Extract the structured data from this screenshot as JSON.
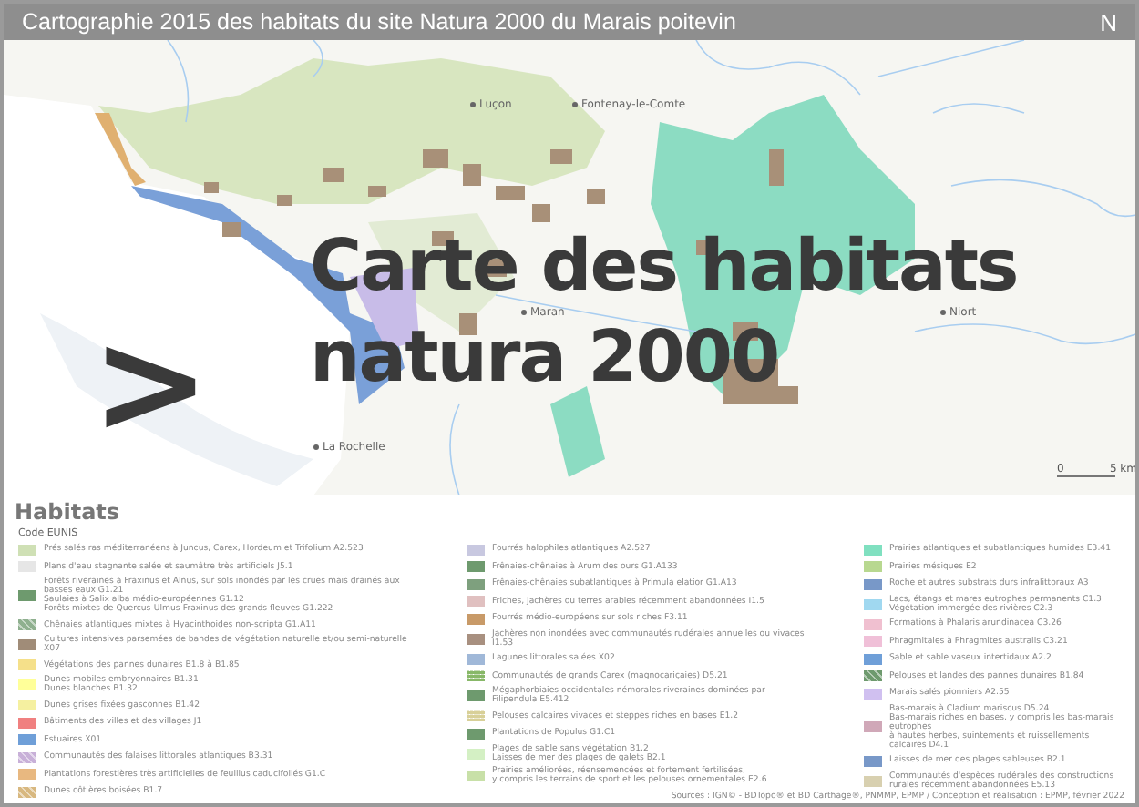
{
  "header": {
    "title": "Cartographie 2015 des habitats du site Natura 2000 du Marais poitevin",
    "north": "N"
  },
  "map": {
    "places": [
      {
        "name": "Luçon"
      },
      {
        "name": "Fontenay-le-Comte"
      },
      {
        "name": "Maran"
      },
      {
        "name": "Niort"
      },
      {
        "name": "La Rochelle"
      }
    ],
    "scale": {
      "start": "0",
      "end": "5 km"
    },
    "overlay": {
      "arrow": ">",
      "title_lines": [
        "Carte des habitats",
        "natura 2000"
      ]
    }
  },
  "legend": {
    "title": "Habitats",
    "subtitle": "Code EUNIS",
    "columns": [
      [
        {
          "lines": [
            "Prés salés ras méditerranéens à Juncus, Carex, Hordeum et Trifolium A2.523"
          ],
          "color": "#cfe0b5",
          "kind": "plain"
        },
        {
          "lines": [
            "Plans d'eau stagnante salée et saumâtre très artificiels J5.1"
          ],
          "color": "#e6e6e6",
          "kind": "plain"
        },
        {
          "lines": [
            "Forêts riveraines à Fraxinus et Alnus, sur sols inondés par les crues mais drainés aux basses eaux G1.21",
            "Saulaies à Salix alba médio-européennes G1.12",
            "Forêts mixtes de Quercus-Ulmus-Fraxinus des grands fleuves G1.222"
          ],
          "color": "#6e9a6e",
          "kind": "plain"
        },
        {
          "lines": [
            "Chênaies atlantiques mixtes à Hyacinthoides non-scripta G1.A11"
          ],
          "color": "#8fb08f",
          "kind": "hatched"
        },
        {
          "lines": [
            "Cultures intensives parsemées de bandes de végétation naturelle et/ou semi-naturelle X07"
          ],
          "color": "#a08c78",
          "kind": "plain"
        },
        {
          "lines": [
            "Végétations des pannes dunaires B1.8 à B1.85"
          ],
          "color": "#f5e08a",
          "kind": "plain"
        },
        {
          "lines": [
            "Dunes mobiles embryonnaires B1.31",
            "Dunes blanches B1.32"
          ],
          "color": "#ffff99",
          "kind": "plain"
        },
        {
          "lines": [
            "Dunes grises fixées gasconnes B1.42"
          ],
          "color": "#f5f0a0",
          "kind": "plain"
        },
        {
          "lines": [
            "Bâtiments des villes et des villages J1"
          ],
          "color": "#f08080",
          "kind": "plain"
        },
        {
          "lines": [
            "Estuaires X01"
          ],
          "color": "#6f9fd8",
          "kind": "plain"
        },
        {
          "lines": [
            "Communautés des falaises littorales atlantiques B3.31"
          ],
          "color": "#c8b0d8",
          "kind": "hatched"
        },
        {
          "lines": [
            "Plantations forestières très artificielles de feuillus caducifoliés G1.C"
          ],
          "color": "#e8b880",
          "kind": "plain"
        },
        {
          "lines": [
            "Dunes côtières boisées B1.7"
          ],
          "color": "#d8b880",
          "kind": "hatched"
        }
      ],
      [
        {
          "lines": [
            "Fourrés halophiles atlantiques A2.527"
          ],
          "color": "#c8c8e0",
          "kind": "plain"
        },
        {
          "lines": [
            "Frênaies-chênaies à Arum des ours G1.A133"
          ],
          "color": "#6e9a6e",
          "kind": "plain"
        },
        {
          "lines": [
            "Frênaies-chênaies subatlantiques à Primula elatior G1.A13"
          ],
          "color": "#7ea07e",
          "kind": "plain"
        },
        {
          "lines": [
            "Friches, jachères ou terres arables récemment abandonnées I1.5"
          ],
          "color": "#e0c0c0",
          "kind": "plain"
        },
        {
          "lines": [
            "Fourrés médio-européens sur sols riches F3.11"
          ],
          "color": "#c89a68",
          "kind": "plain"
        },
        {
          "lines": [
            "Jachères non inondées avec communautés rudérales annuelles ou vivaces I1.53"
          ],
          "color": "#a89080",
          "kind": "plain"
        },
        {
          "lines": [
            "Lagunes littorales salées X02"
          ],
          "color": "#a0b8d8",
          "kind": "plain"
        },
        {
          "lines": [
            "Communautés de grands Carex (magnocariçaies) D5.21"
          ],
          "color": "#88b868",
          "kind": "grid"
        },
        {
          "lines": [
            "Mégaphorbiaies occidentales némorales riveraines dominées par Filipendula E5.412"
          ],
          "color": "#6e9a6e",
          "kind": "plain"
        },
        {
          "lines": [
            "Pelouses calcaires vivaces et steppes riches en bases E1.2"
          ],
          "color": "#d8d098",
          "kind": "grid"
        },
        {
          "lines": [
            "Plantations de Populus G1.C1"
          ],
          "color": "#6e9a6e",
          "kind": "plain"
        },
        {
          "lines": [
            "Plages de sable sans végétation B1.2",
            "Laisses de mer des plages de galets B2.1"
          ],
          "color": "#d4f0c4",
          "kind": "plain"
        },
        {
          "lines": [
            "Prairies améliorées, réensemencées et fortement fertilisées,",
            "y compris les terrains de sport et les pelouses ornementales E2.6"
          ],
          "color": "#c8e0a8",
          "kind": "plain"
        }
      ],
      [
        {
          "lines": [
            "Prairies atlantiques et subatlantiques humides E3.41"
          ],
          "color": "#80e0c0",
          "kind": "plain"
        },
        {
          "lines": [
            "Prairies mésiques E2"
          ],
          "color": "#b8d890",
          "kind": "plain"
        },
        {
          "lines": [
            "Roche et autres substrats durs infralittoraux A3"
          ],
          "color": "#7898c8",
          "kind": "plain"
        },
        {
          "lines": [
            "Lacs, étangs et mares eutrophes permanents C1.3",
            "Végétation immergée des rivières C2.3"
          ],
          "color": "#a0d8f0",
          "kind": "plain"
        },
        {
          "lines": [
            "Formations à Phalaris arundinacea C3.26"
          ],
          "color": "#f0c0d0",
          "kind": "plain"
        },
        {
          "lines": [
            "Phragmitaies à Phragmites australis C3.21"
          ],
          "color": "#f0c0d8",
          "kind": "plain"
        },
        {
          "lines": [
            "Sable et sable vaseux intertidaux A2.2"
          ],
          "color": "#6f9fd8",
          "kind": "plain"
        },
        {
          "lines": [
            "Pelouses et landes des pannes dunaires B1.84"
          ],
          "color": "#6e9a6e",
          "kind": "hatched"
        },
        {
          "lines": [
            "Marais salés pionniers A2.55"
          ],
          "color": "#d0c0f0",
          "kind": "plain"
        },
        {
          "lines": [
            "Bas-marais à Cladium mariscus D5.24",
            "Bas-marais riches en bases, y compris les bas-marais eutrophes",
            "à hautes herbes, suintements et ruissellements calcaires D4.1"
          ],
          "color": "#d0a8b8",
          "kind": "plain"
        },
        {
          "lines": [
            "Laisses de mer des plages sableuses B2.1"
          ],
          "color": "#7898c8",
          "kind": "plain"
        },
        {
          "lines": [
            "Communautés d'espèces rudérales des constructions",
            "rurales récemment abandonnées E5.13"
          ],
          "color": "#d8d0b0",
          "kind": "plain"
        }
      ]
    ]
  },
  "sources": "Sources : IGN© - BDTopo® et BD Carthage®, PNMMP, EPMP / Conception et réalisation : EPMP, février 2022"
}
